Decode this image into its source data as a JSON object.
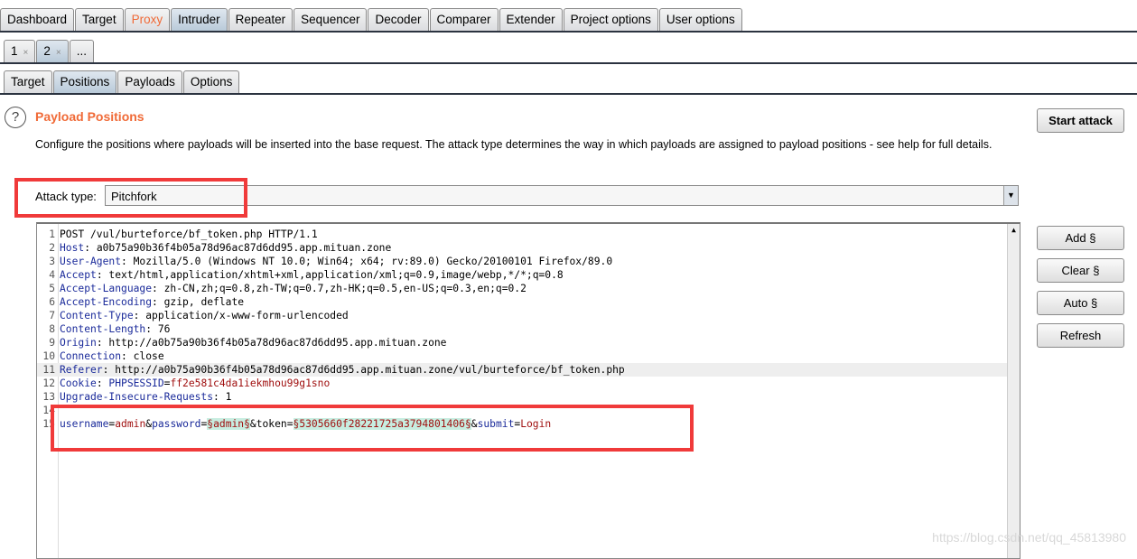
{
  "main_tabs": [
    "Dashboard",
    "Target",
    "Proxy",
    "Intruder",
    "Repeater",
    "Sequencer",
    "Decoder",
    "Comparer",
    "Extender",
    "Project options",
    "User options"
  ],
  "main_tab_selected": "Intruder",
  "proxy_color": "#f06a37",
  "attack_tabs": [
    {
      "label": "1",
      "close": "×"
    },
    {
      "label": "2",
      "close": "×"
    },
    {
      "label": "...",
      "close": ""
    }
  ],
  "sub_tabs": [
    "Target",
    "Positions",
    "Payloads",
    "Options"
  ],
  "sub_tab_selected": "Positions",
  "help_icon": "?",
  "title": "Payload Positions",
  "description": "Configure the positions where payloads will be inserted into the base request. The attack type determines the way in which payloads are assigned to payload positions - see help for full details.",
  "start_attack": "Start attack",
  "attack_type_label": "Attack type:",
  "attack_type_value": "Pitchfork",
  "side_buttons": [
    "Add §",
    "Clear §",
    "Auto §",
    "Refresh"
  ],
  "request_lines": [
    [
      [
        "POST /vul/burteforce/bf_token.php HTTP/1.1",
        ""
      ]
    ],
    [
      [
        "Host",
        ""
      ],
      [
        ": a0b75a90b36f4b05a78d96ac87d6dd95.app.mituan.zone",
        ""
      ]
    ],
    [
      [
        "User-Agent",
        "k"
      ],
      [
        ": Mozilla/5.0 (Windows NT 10.0; Win64; x64; rv:89.0) Gecko/20100101 Firefox/89.0",
        ""
      ]
    ],
    [
      [
        "Accept",
        "k"
      ],
      [
        ": text/html,application/xhtml+xml,application/xml;q=0.9,image/webp,*/*;q=0.8",
        ""
      ]
    ],
    [
      [
        "Accept-Language",
        "k"
      ],
      [
        ": zh-CN,zh;q=0.8,zh-TW;q=0.7,zh-HK;q=0.5,en-US;q=0.3,en;q=0.2",
        ""
      ]
    ],
    [
      [
        "Accept-Encoding",
        "k"
      ],
      [
        ": gzip, deflate",
        ""
      ]
    ],
    [
      [
        "Content-Type",
        "k"
      ],
      [
        ": application/x-www-form-urlencoded",
        ""
      ]
    ],
    [
      [
        "Content-Length",
        "k"
      ],
      [
        ": 76",
        ""
      ]
    ],
    [
      [
        "Origin",
        "k"
      ],
      [
        ": http://a0b75a90b36f4b05a78d96ac87d6dd95.app.mituan.zone",
        ""
      ]
    ],
    [
      [
        "Connection",
        "k"
      ],
      [
        ": close",
        ""
      ]
    ],
    [
      [
        "Referer",
        "k"
      ],
      [
        ": http://a0b75a90b36f4b05a78d96ac87d6dd95.app.mituan.zone/vul/burteforce/bf_token.php",
        ""
      ]
    ],
    [
      [
        "Cookie",
        "k"
      ],
      [
        ": ",
        ""
      ],
      [
        "PHPSESSID",
        "k"
      ],
      [
        "=",
        ""
      ],
      [
        "ff2e581c4da1iekmhou99g1sno",
        "r"
      ]
    ],
    [
      [
        "Upgrade-Insecure-Requests",
        "k"
      ],
      [
        ": 1",
        ""
      ]
    ],
    [],
    [
      [
        "username",
        "k"
      ],
      [
        "=",
        ""
      ],
      [
        "admin",
        "r"
      ],
      [
        "&",
        ""
      ],
      [
        "password",
        "k"
      ],
      [
        "=",
        ""
      ],
      [
        "§admin§",
        "p"
      ],
      [
        "&token=",
        ""
      ],
      [
        "§5305660f28221725a3794801406§",
        "p"
      ],
      [
        "&",
        ""
      ],
      [
        "submit",
        "k"
      ],
      [
        "=",
        ""
      ],
      [
        "Login",
        "r"
      ]
    ]
  ],
  "highlighted_line": 11,
  "watermark": "https://blog.csdn.net/qq_45813980"
}
